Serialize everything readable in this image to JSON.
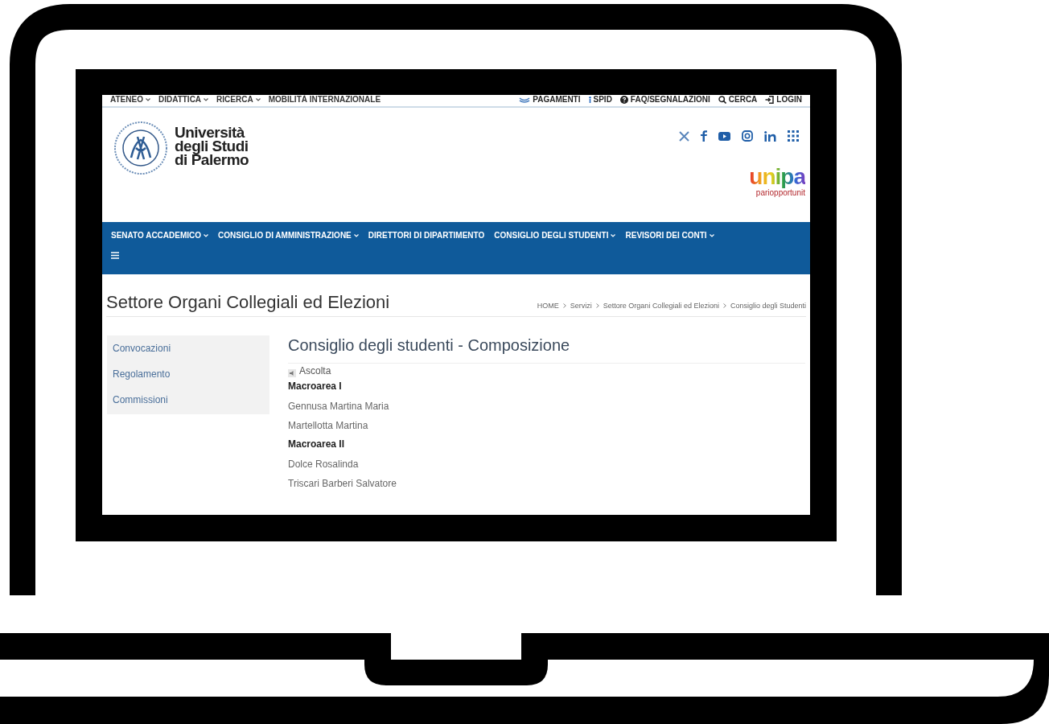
{
  "top_menu": [
    {
      "label": "ATENEO",
      "dropdown": true
    },
    {
      "label": "DIDATTICA",
      "dropdown": true
    },
    {
      "label": "RICERCA",
      "dropdown": true
    },
    {
      "label": "MOBILITÀ INTERNAZIONALE",
      "dropdown": false
    }
  ],
  "top_links": [
    {
      "kind": "payment",
      "label": "PAGAMENTI"
    },
    {
      "kind": "spid",
      "label": "SPID"
    },
    {
      "kind": "faq",
      "label": "FAQ/SEGNALAZIONI"
    },
    {
      "kind": "search",
      "label": "CERCA"
    },
    {
      "kind": "login",
      "label": "LOGIN"
    }
  ],
  "logo": {
    "lines": [
      "Università",
      "degli Studi",
      "di Palermo"
    ]
  },
  "badge": {
    "word": "unipa",
    "tagline": "pariopportunit"
  },
  "nav": [
    {
      "label": "SENATO ACCADEMICO",
      "dropdown": true
    },
    {
      "label": "CONSIGLIO DI AMMINISTRAZIONE",
      "dropdown": true
    },
    {
      "label": "DIRETTORI DI DIPARTIMENTO",
      "dropdown": false
    },
    {
      "label": "CONSIGLIO DEGLI STUDENTI",
      "dropdown": true
    },
    {
      "label": "REVISORI DEI CONTI",
      "dropdown": true
    }
  ],
  "section_title": "Settore Organi Collegiali ed Elezioni",
  "breadcrumb": [
    "HOME",
    "Servizi",
    "Settore Organi Collegiali ed Elezioni",
    "Consiglio degli Studenti"
  ],
  "sidebar": [
    {
      "label": "Convocazioni"
    },
    {
      "label": "Regolamento"
    },
    {
      "label": "Commissioni"
    }
  ],
  "page_title": "Consiglio degli studenti - Composizione",
  "listen_label": "Ascolta",
  "members": [
    {
      "kind": "heading",
      "text": "Macroarea I"
    },
    {
      "kind": "name",
      "text": "Gennusa Martina Maria"
    },
    {
      "kind": "name",
      "text": "Martellotta Martina"
    },
    {
      "kind": "heading",
      "text": "Macroarea II"
    },
    {
      "kind": "name",
      "text": "Dolce Rosalinda"
    },
    {
      "kind": "name",
      "text": "Triscari Barberi Salvatore"
    }
  ]
}
